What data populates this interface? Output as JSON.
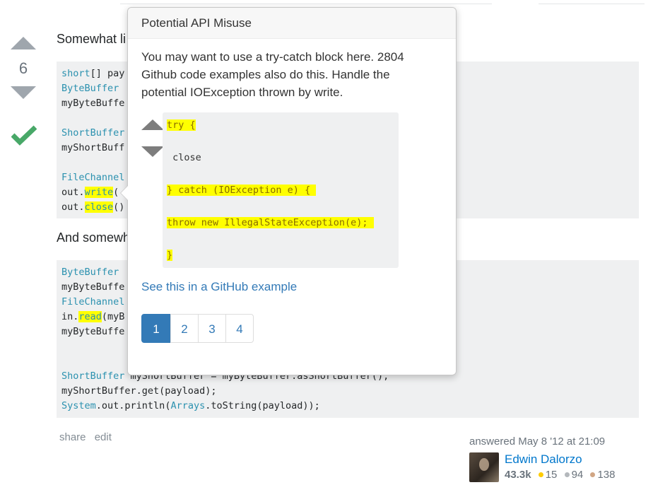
{
  "vote": {
    "count": "6"
  },
  "answer": {
    "intro_text": "Somewhat li",
    "middle_text": "And somewh",
    "code1": [
      [
        {
          "t": "short",
          "c": "kw"
        },
        {
          "t": "[] pay"
        }
      ],
      [
        {
          "t": "ByteBuffer",
          "c": "kw"
        },
        {
          "t": " "
        }
      ],
      [
        {
          "t": "myByteBuffe"
        }
      ],
      [],
      [
        {
          "t": "ShortBuffer",
          "c": "kw"
        }
      ],
      [
        {
          "t": "myShortBuff"
        }
      ],
      [],
      [
        {
          "t": "FileChannel",
          "c": "kw"
        },
        {
          "t": "                                                    ();"
        }
      ],
      [
        {
          "t": "out."
        },
        {
          "t": "write",
          "c": "hl"
        },
        {
          "t": "("
        }
      ],
      [
        {
          "t": "out."
        },
        {
          "t": "close",
          "c": "hl"
        },
        {
          "t": "()"
        }
      ]
    ],
    "code2": [
      [
        {
          "t": "ByteBuffer",
          "c": "kw"
        },
        {
          "t": " "
        }
      ],
      [
        {
          "t": "myByteBuffe"
        }
      ],
      [
        {
          "t": "FileChannel",
          "c": "kw"
        },
        {
          "t": "                                                    ;"
        }
      ],
      [
        {
          "t": "in."
        },
        {
          "t": "read",
          "c": "hl"
        },
        {
          "t": "(myB"
        }
      ],
      [
        {
          "t": "myByteBuffe"
        }
      ],
      [],
      [],
      [
        {
          "t": "ShortBuffer",
          "c": "kw"
        },
        {
          "t": " myShortBuffer = myByteBuffer.asShortBuffer();"
        }
      ],
      [
        {
          "t": "myShortBuffer.get(payload);"
        }
      ],
      [
        {
          "t": "System",
          "c": "kw"
        },
        {
          "t": ".out.println("
        },
        {
          "t": "Arrays",
          "c": "kw"
        },
        {
          "t": ".toString(payload));"
        }
      ]
    ],
    "menu": {
      "share": "share",
      "edit": "edit"
    },
    "signature": {
      "time": "answered May 8 '12 at 21:09",
      "name": "Edwin Dalorzo",
      "rep": "43.3k",
      "gold": "15",
      "silver": "94",
      "bronze": "138"
    }
  },
  "popover": {
    "title": "Potential API Misuse",
    "message": "You may want to use a try-catch block here. 2804 Github code examples also do this. Handle the potential IOException thrown by write.",
    "snippet": [
      {
        "text": "try {",
        "highlight": true
      },
      {
        "text": " close",
        "highlight": false
      },
      {
        "text": "} catch (IOException e) { ",
        "highlight": true
      },
      {
        "text": "throw new IllegalStateException(e); ",
        "highlight": true
      },
      {
        "text": "}",
        "highlight": true
      }
    ],
    "link": "See this in a GitHub example",
    "pages": [
      "1",
      "2",
      "3",
      "4"
    ],
    "active_page": "1"
  }
}
